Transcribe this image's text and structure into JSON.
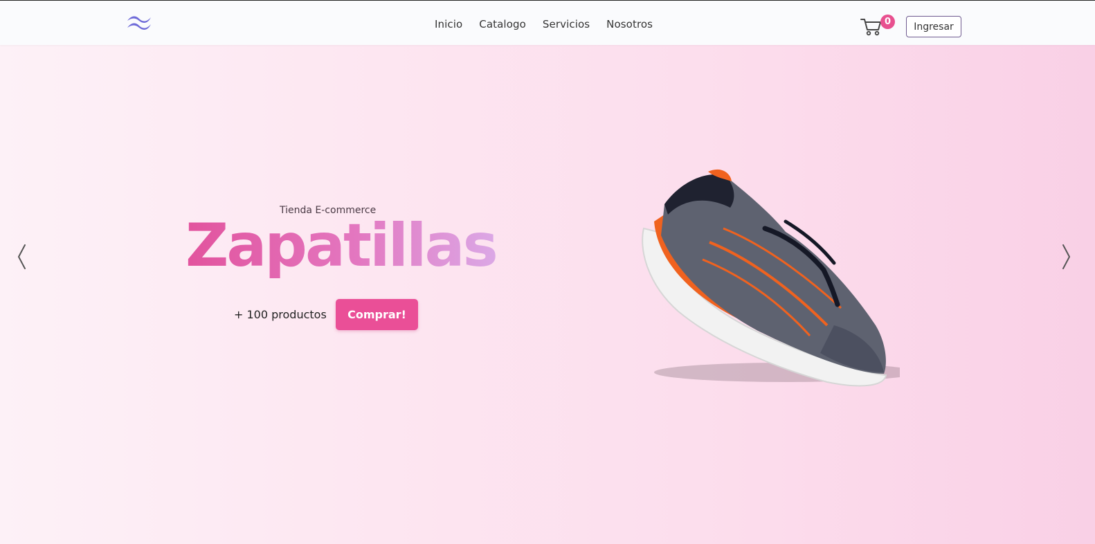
{
  "header": {
    "logo_icon": "wave-logo-icon",
    "nav": [
      {
        "label": "Inicio"
      },
      {
        "label": "Catalogo"
      },
      {
        "label": "Servicios"
      },
      {
        "label": "Nosotros"
      }
    ],
    "cart": {
      "icon": "shopping-cart-icon",
      "count": "0"
    },
    "login_label": "Ingresar"
  },
  "hero": {
    "subtitle": "Tienda E-commerce",
    "title": "Zapatillas",
    "products_count": "+ 100 productos",
    "buy_label": "Comprar!",
    "image": "running-shoe-image",
    "prev_icon": "chevron-left-icon",
    "next_icon": "chevron-right-icon"
  },
  "colors": {
    "accent": "#ea4f97",
    "logo": "#6e6ad8",
    "hero_bg_start": "#fdf1f7",
    "hero_bg_end": "#f9d0e6"
  }
}
